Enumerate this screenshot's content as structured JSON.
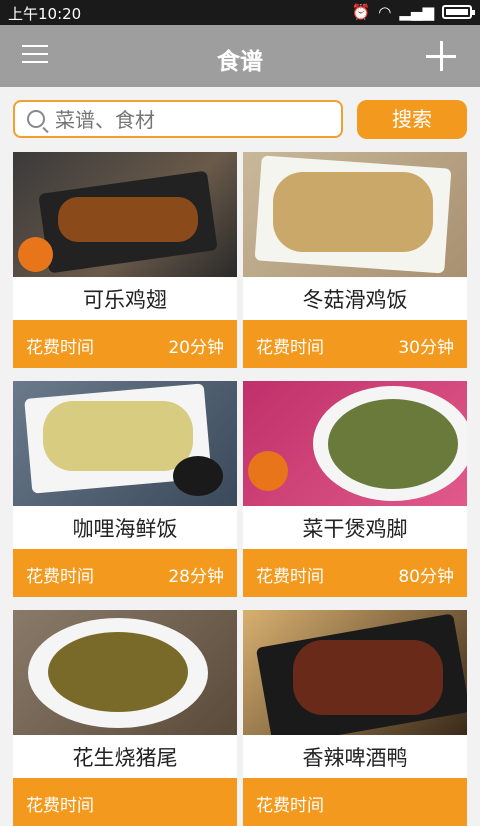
{
  "status": {
    "time": "上午10:20"
  },
  "appbar": {
    "title": "食谱"
  },
  "search": {
    "placeholder": "菜谱、食材",
    "button": "搜索"
  },
  "recipes": [
    {
      "name": "可乐鸡翅",
      "time_label": "花费时间",
      "time": "20分钟"
    },
    {
      "name": "冬菇滑鸡饭",
      "time_label": "花费时间",
      "time": "30分钟"
    },
    {
      "name": "咖哩海鲜饭",
      "time_label": "花费时间",
      "time": "28分钟"
    },
    {
      "name": "菜干煲鸡脚",
      "time_label": "花费时间",
      "time": "80分钟"
    },
    {
      "name": "花生烧猪尾",
      "time_label": "花费时间",
      "time": ""
    },
    {
      "name": "香辣啤酒鸭",
      "time_label": "花费时间",
      "time": ""
    }
  ],
  "colors": {
    "accent": "#f39a1e",
    "appbar": "#9e9e9e"
  }
}
